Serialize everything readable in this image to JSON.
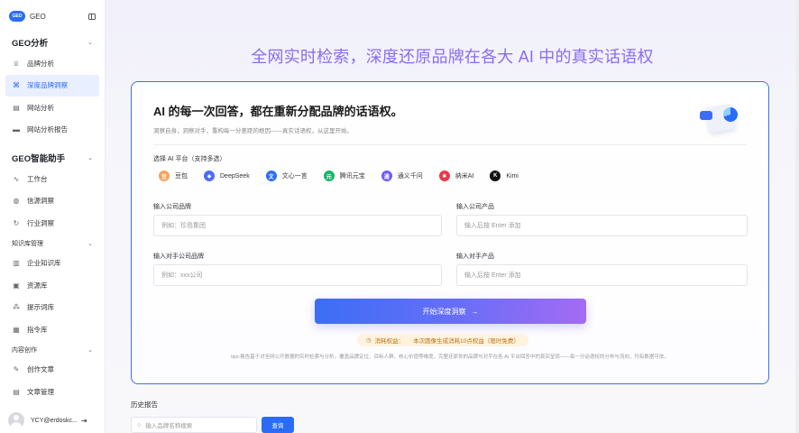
{
  "sidebar": {
    "brand": {
      "logo_text": "GEO",
      "name": "GEO"
    },
    "groups": [
      {
        "title": "GEO分析",
        "items": [
          {
            "label": "品牌分析",
            "icon": "crown-icon",
            "glyph": "♕",
            "active": false
          },
          {
            "label": "深度品牌洞察",
            "icon": "insight-icon",
            "glyph": "⌘",
            "active": true
          },
          {
            "label": "网站分析",
            "icon": "document-icon",
            "glyph": "▤",
            "active": false
          },
          {
            "label": "网站分析报告",
            "icon": "folder-icon",
            "glyph": "▬",
            "active": false
          }
        ]
      },
      {
        "title": "GEO智能助手",
        "items": [
          {
            "label": "工作台",
            "icon": "chart-icon",
            "glyph": "∿",
            "active": false
          },
          {
            "label": "信源洞察",
            "icon": "globe-icon",
            "glyph": "◍",
            "active": false
          },
          {
            "label": "行业洞察",
            "icon": "refresh-icon",
            "glyph": "↻",
            "active": false
          }
        ]
      },
      {
        "title": "知识库管理",
        "items": [
          {
            "label": "企业知识库",
            "icon": "library-icon",
            "glyph": "▥",
            "active": false
          },
          {
            "label": "资源库",
            "icon": "box-icon",
            "glyph": "▣",
            "active": false
          },
          {
            "label": "提示词库",
            "icon": "magic-wand-icon",
            "glyph": "⁂",
            "active": false
          },
          {
            "label": "指令库",
            "icon": "instruction-icon",
            "glyph": "▦",
            "active": false
          }
        ]
      },
      {
        "title": "内容创作",
        "items": [
          {
            "label": "创作文章",
            "icon": "edit-icon",
            "glyph": "✎",
            "active": false
          },
          {
            "label": "文章管理",
            "icon": "file-icon",
            "glyph": "▤",
            "active": false
          }
        ]
      }
    ],
    "user": {
      "name": "YCY@erdoskc..."
    }
  },
  "main": {
    "hero_title": "全网实时检索，深度还原品牌在各大 AI 中的真实话语权",
    "card": {
      "title": "AI 的每一次回答，都在重新分配品牌的话语权。",
      "subtitle": "洞察自身，洞察对手，重构每一分差距的根因——真实话语权，从这里开始。",
      "platform_label": "选择 AI 平台（支持多选）",
      "platforms": [
        {
          "name": "豆包",
          "icon": "doubao-icon",
          "color": "#f4a35c",
          "glyph": "豆"
        },
        {
          "name": "DeepSeek",
          "icon": "deepseek-icon",
          "color": "#4d6bfe",
          "glyph": "◆"
        },
        {
          "name": "文心一言",
          "icon": "wenxin-icon",
          "color": "#2b6cf6",
          "glyph": "文"
        },
        {
          "name": "腾讯元宝",
          "icon": "yuanbao-icon",
          "color": "#1bb36a",
          "glyph": "元"
        },
        {
          "name": "通义千问",
          "icon": "tongyi-icon",
          "color": "#6b5cf6",
          "glyph": "通"
        },
        {
          "name": "纳米AI",
          "icon": "nami-icon",
          "color": "#e8394a",
          "glyph": "✱"
        },
        {
          "name": "Kimi",
          "icon": "kimi-icon",
          "color": "#111111",
          "glyph": "K"
        }
      ],
      "fields": {
        "company_brand": {
          "label": "输入公司品牌",
          "placeholder": "例如：珍島集团"
        },
        "company_product": {
          "label": "输入公司产品",
          "placeholder": "输入后按 Enter 添加"
        },
        "competitor_brand": {
          "label": "输入对手公司品牌",
          "placeholder": "例如：xxx公司"
        },
        "competitor_product": {
          "label": "输入对手产品",
          "placeholder": "输入后按 Enter 添加"
        }
      },
      "start_button": "开始深度洞察",
      "cost": {
        "label": "消耗权益：",
        "value": "本次圆像生成消耗10点权益（限时免费）"
      },
      "tips": "tips:报告基于对全网公开数据的实时检索与分析，覆盖品牌定位、目标人群、核心价值等维度，完整还原你的品牌与对手在各 AI 平台回答中的真实呈现——每一分话语权的分布与流向，均有数据可依。"
    },
    "history": {
      "title": "历史报告",
      "search_placeholder": "输入品牌名称搜索",
      "query_button": "查询"
    }
  }
}
